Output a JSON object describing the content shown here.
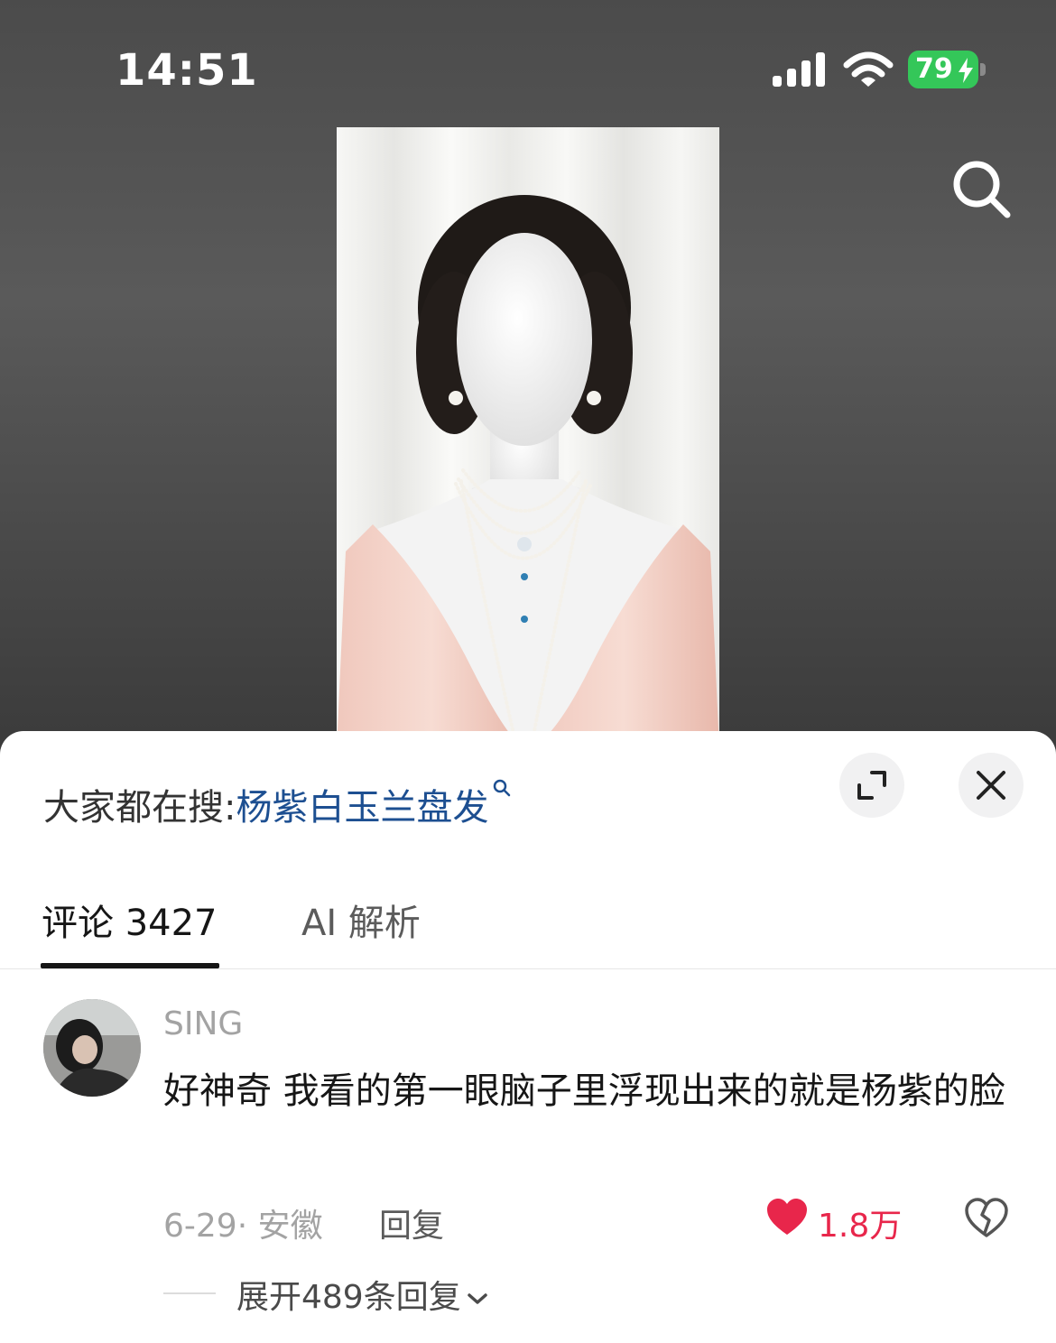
{
  "status_bar": {
    "time": "14:51",
    "battery": "79"
  },
  "icons": {
    "search": "search-icon",
    "signal": "cellular-signal-icon",
    "wifi": "wifi-icon",
    "battery": "battery-charging-icon",
    "expand": "fullscreen-expand-icon",
    "close": "close-icon",
    "like": "heart-icon",
    "dislike": "broken-heart-icon",
    "chevron": "chevron-down-icon"
  },
  "colors": {
    "link": "#1d4f91",
    "like": "#e8264b",
    "battery": "#34c759"
  },
  "search_hint": {
    "prefix": "大家都在搜:",
    "keyword": "杨紫白玉兰盘发"
  },
  "tabs": [
    {
      "label": "评论 3427",
      "active": true
    },
    {
      "label": "AI 解析",
      "active": false
    }
  ],
  "comment": {
    "username": "SING",
    "text": "好神奇 我看的第一眼脑子里浮现出来的就是杨紫的脸",
    "meta": "6-29· 安徽",
    "reply_label": "回复",
    "like_count": "1.8万",
    "expand_label": "展开489条回复"
  }
}
